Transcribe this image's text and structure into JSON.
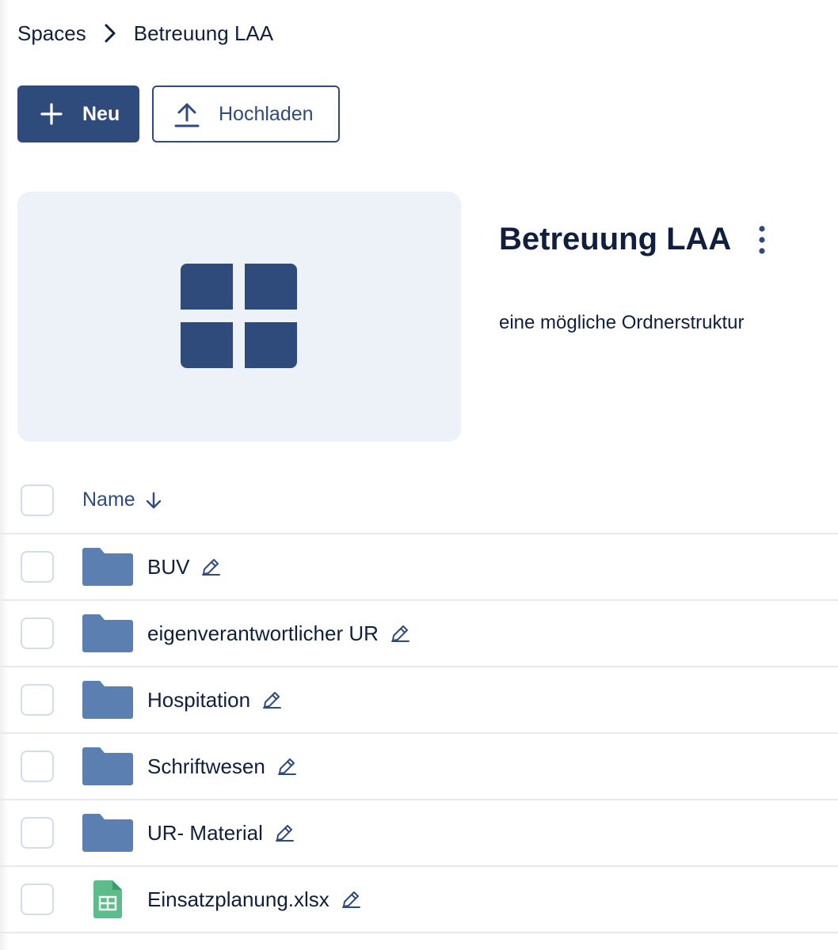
{
  "breadcrumb": {
    "root": "Spaces",
    "current": "Betreuung LAA"
  },
  "actions": {
    "new_label": "Neu",
    "upload_label": "Hochladen"
  },
  "space": {
    "title": "Betreuung LAA",
    "description": "eine mögliche Ordnerstruktur"
  },
  "table": {
    "name_header": "Name",
    "sort": "descending",
    "rows": [
      {
        "name": "BUV",
        "type": "folder"
      },
      {
        "name": "eigenverantwortlicher UR",
        "type": "folder"
      },
      {
        "name": "Hospitation",
        "type": "folder"
      },
      {
        "name": "Schriftwesen",
        "type": "folder"
      },
      {
        "name": "UR- Material",
        "type": "folder"
      },
      {
        "name": "Einsatzplanung.xlsx",
        "type": "spreadsheet"
      }
    ]
  },
  "colors": {
    "primary": "#2f4b7c",
    "folder": "#5a7fb0",
    "spreadsheet": "#5cbd8a",
    "space_bg": "#edf2f8"
  }
}
